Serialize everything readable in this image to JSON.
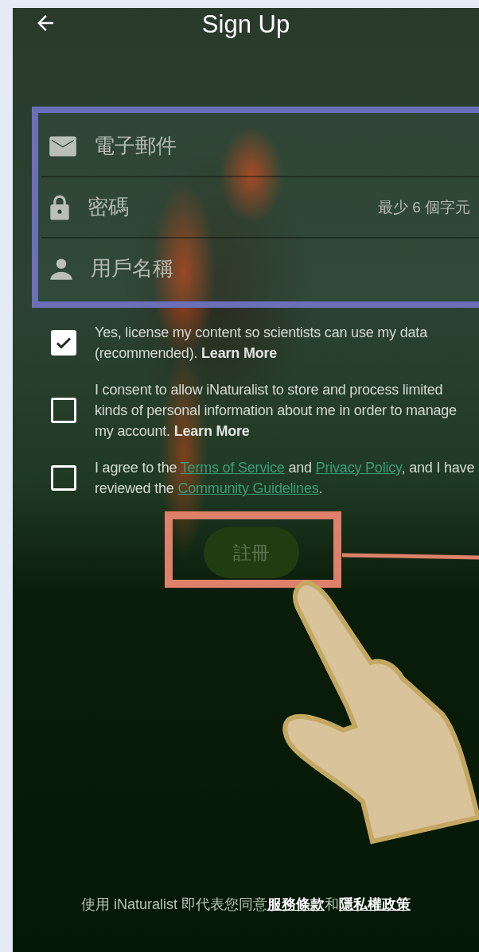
{
  "header": {
    "title": "Sign Up"
  },
  "fields": [
    {
      "kind": "email",
      "placeholder": "電子郵件"
    },
    {
      "kind": "password",
      "placeholder": "密碼",
      "hint": "最少 6 個字元"
    },
    {
      "kind": "username",
      "placeholder": "用戶名稱"
    }
  ],
  "agreements": [
    {
      "checked": true,
      "parts": [
        {
          "kind": "plain",
          "text": "Yes, license my content so scientists can use my data (recommended). "
        },
        {
          "kind": "bold_link",
          "text": "Learn More"
        }
      ]
    },
    {
      "checked": false,
      "parts": [
        {
          "kind": "plain",
          "text": "I consent to allow iNaturalist to store and process limited kinds of personal information about me in order to manage my account. "
        },
        {
          "kind": "bold_link",
          "text": "Learn More"
        }
      ]
    },
    {
      "checked": false,
      "parts": [
        {
          "kind": "plain",
          "text": "I agree to the "
        },
        {
          "kind": "link",
          "text": "Terms of Service"
        },
        {
          "kind": "plain",
          "text": " and "
        },
        {
          "kind": "link",
          "text": "Privacy Policy"
        },
        {
          "kind": "plain",
          "text": ", and I have reviewed the "
        },
        {
          "kind": "link",
          "text": "Community Guidelines"
        },
        {
          "kind": "plain",
          "text": "."
        }
      ]
    }
  ],
  "signup_button": {
    "label": "註冊",
    "disabled": true
  },
  "footer": {
    "parts": [
      {
        "kind": "plain",
        "text": "使用 iNaturalist 即代表您同意"
      },
      {
        "kind": "link",
        "text": "服務條款"
      },
      {
        "kind": "plain",
        "text": "和"
      },
      {
        "kind": "link",
        "text": "隱私權政策"
      }
    ]
  }
}
